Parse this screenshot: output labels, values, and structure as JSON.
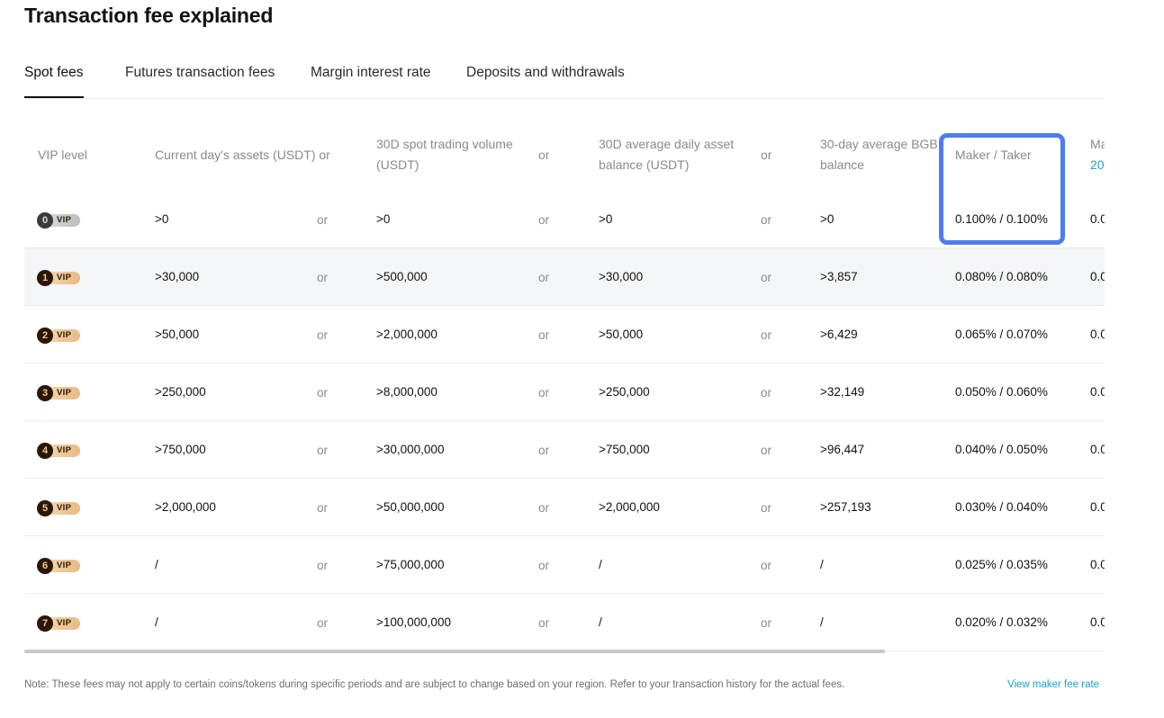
{
  "page_title": "Transaction fee explained",
  "tabs": [
    {
      "label": "Spot fees",
      "active": true
    },
    {
      "label": "Futures transaction fees",
      "active": false
    },
    {
      "label": "Margin interest rate",
      "active": false
    },
    {
      "label": "Deposits and withdrawals",
      "active": false
    }
  ],
  "table": {
    "headers": {
      "vip_level": "VIP level",
      "current_assets": "Current day's assets (USDT) or",
      "spot_volume_line1": "30D spot trading volume",
      "spot_volume_line2": "(USDT)",
      "avg_balance_line1": "30D average daily asset",
      "avg_balance_line2": "balance (USDT)",
      "bgb_line1": "30-day average BGB",
      "bgb_line2": "balance",
      "maker_taker": "Maker / Taker",
      "next_col_line1": "Ma",
      "next_col_line2": "20",
      "or": "or"
    },
    "or_label": "or",
    "vip_badge_text": "VIP",
    "rows": [
      {
        "level": "0",
        "assets": ">0",
        "volume": ">0",
        "balance": ">0",
        "bgb": ">0",
        "fee": "0.100% / 0.100%",
        "next": "0.0"
      },
      {
        "level": "1",
        "assets": ">30,000",
        "volume": ">500,000",
        "balance": ">30,000",
        "bgb": ">3,857",
        "fee": "0.080% / 0.080%",
        "next": "0.0"
      },
      {
        "level": "2",
        "assets": ">50,000",
        "volume": ">2,000,000",
        "balance": ">50,000",
        "bgb": ">6,429",
        "fee": "0.065% / 0.070%",
        "next": "0.0"
      },
      {
        "level": "3",
        "assets": ">250,000",
        "volume": ">8,000,000",
        "balance": ">250,000",
        "bgb": ">32,149",
        "fee": "0.050% / 0.060%",
        "next": "0.0"
      },
      {
        "level": "4",
        "assets": ">750,000",
        "volume": ">30,000,000",
        "balance": ">750,000",
        "bgb": ">96,447",
        "fee": "0.040% / 0.050%",
        "next": "0.0"
      },
      {
        "level": "5",
        "assets": ">2,000,000",
        "volume": ">50,000,000",
        "balance": ">2,000,000",
        "bgb": ">257,193",
        "fee": "0.030% / 0.040%",
        "next": "0.0"
      },
      {
        "level": "6",
        "assets": "/",
        "volume": ">75,000,000",
        "balance": "/",
        "bgb": "/",
        "fee": "0.025% / 0.035%",
        "next": "0.0"
      },
      {
        "level": "7",
        "assets": "/",
        "volume": ">100,000,000",
        "balance": "/",
        "bgb": "/",
        "fee": "0.020% / 0.032%",
        "next": "0.0"
      }
    ]
  },
  "footer": {
    "note": "Note: These fees may not apply to certain coins/tokens during specific periods and are subject to change based on your region. Refer to your transaction history for the actual fees.",
    "view_link": "View maker fee rate"
  },
  "colors": {
    "highlight": "#4d7cf2",
    "link": "#1aa3c8",
    "shaded_row": "#f4f5f6"
  }
}
